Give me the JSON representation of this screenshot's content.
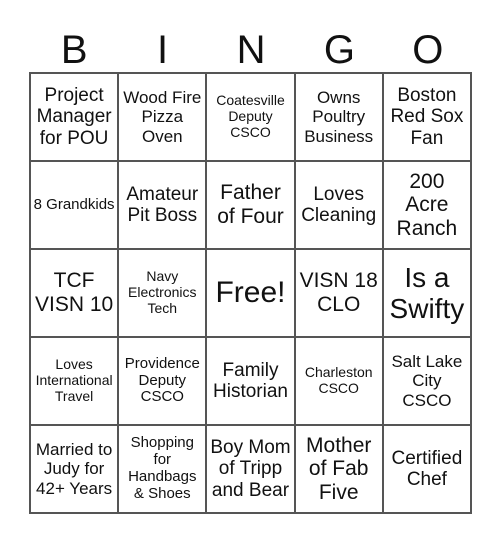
{
  "header": [
    "B",
    "I",
    "N",
    "G",
    "O"
  ],
  "cells": [
    "Project Manager for POU",
    "Wood Fire Pizza Oven",
    "Coatesville Deputy CSCO",
    "Owns Poultry Business",
    "Boston Red Sox Fan",
    "8 Grandkids",
    "Amateur Pit Boss",
    "Father of Four",
    "Loves Cleaning",
    "200 Acre Ranch",
    "TCF VISN 10",
    "Navy Electronics Tech",
    "Free!",
    "VISN 18 CLO",
    "Is a Swifty",
    "Loves International Travel",
    "Providence Deputy CSCO",
    "Family Historian",
    "Charleston CSCO",
    "Salt Lake City CSCO",
    "Married to Judy for 42+ Years",
    "Shopping for Handbags & Shoes",
    "Boy Mom of Tripp and Bear",
    "Mother of Fab Five",
    "Certified Chef"
  ]
}
